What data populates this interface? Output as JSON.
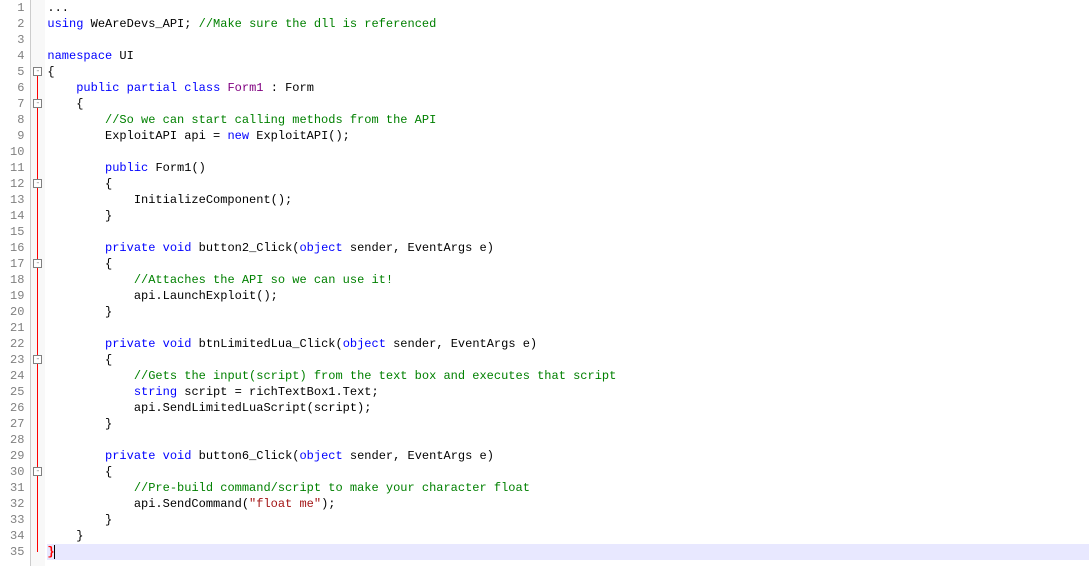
{
  "lines": [
    {
      "n": 1,
      "tokens": [
        {
          "t": "...",
          "c": "ident"
        }
      ]
    },
    {
      "n": 2,
      "tokens": [
        {
          "t": "using",
          "c": "kw"
        },
        {
          "t": " ",
          "c": ""
        },
        {
          "t": "WeAreDevs_API",
          "c": "ns"
        },
        {
          "t": ";",
          "c": "punct"
        },
        {
          "t": " ",
          "c": ""
        },
        {
          "t": "//Make sure the dll is referenced",
          "c": "comment"
        }
      ]
    },
    {
      "n": 3,
      "tokens": []
    },
    {
      "n": 4,
      "tokens": [
        {
          "t": "namespace",
          "c": "kw"
        },
        {
          "t": " ",
          "c": ""
        },
        {
          "t": "UI",
          "c": "ns"
        }
      ]
    },
    {
      "n": 5,
      "tokens": [
        {
          "t": "{",
          "c": "punct"
        }
      ],
      "fold": true
    },
    {
      "n": 6,
      "tokens": [
        {
          "t": "    ",
          "c": ""
        },
        {
          "t": "public",
          "c": "kw"
        },
        {
          "t": " ",
          "c": ""
        },
        {
          "t": "partial",
          "c": "kw"
        },
        {
          "t": " ",
          "c": ""
        },
        {
          "t": "class",
          "c": "kw"
        },
        {
          "t": " ",
          "c": ""
        },
        {
          "t": "Form1",
          "c": "purple"
        },
        {
          "t": " : ",
          "c": "punct"
        },
        {
          "t": "Form",
          "c": "cls"
        }
      ]
    },
    {
      "n": 7,
      "tokens": [
        {
          "t": "    {",
          "c": "punct"
        }
      ],
      "fold": true
    },
    {
      "n": 8,
      "tokens": [
        {
          "t": "        ",
          "c": ""
        },
        {
          "t": "//So we can start calling methods from the API",
          "c": "comment"
        }
      ]
    },
    {
      "n": 9,
      "tokens": [
        {
          "t": "        ",
          "c": ""
        },
        {
          "t": "ExploitAPI",
          "c": "cls"
        },
        {
          "t": " api = ",
          "c": "ident"
        },
        {
          "t": "new",
          "c": "kw"
        },
        {
          "t": " ",
          "c": ""
        },
        {
          "t": "ExploitAPI",
          "c": "cls"
        },
        {
          "t": "();",
          "c": "punct"
        }
      ]
    },
    {
      "n": 10,
      "tokens": []
    },
    {
      "n": 11,
      "tokens": [
        {
          "t": "        ",
          "c": ""
        },
        {
          "t": "public",
          "c": "kw"
        },
        {
          "t": " ",
          "c": ""
        },
        {
          "t": "Form1",
          "c": "cls"
        },
        {
          "t": "()",
          "c": "punct"
        }
      ]
    },
    {
      "n": 12,
      "tokens": [
        {
          "t": "        {",
          "c": "punct"
        }
      ],
      "fold": true
    },
    {
      "n": 13,
      "tokens": [
        {
          "t": "            InitializeComponent();",
          "c": "ident"
        }
      ]
    },
    {
      "n": 14,
      "tokens": [
        {
          "t": "        }",
          "c": "punct"
        }
      ]
    },
    {
      "n": 15,
      "tokens": []
    },
    {
      "n": 16,
      "tokens": [
        {
          "t": "        ",
          "c": ""
        },
        {
          "t": "private",
          "c": "kw"
        },
        {
          "t": " ",
          "c": ""
        },
        {
          "t": "void",
          "c": "kw"
        },
        {
          "t": " ",
          "c": ""
        },
        {
          "t": "button2_Click",
          "c": "method"
        },
        {
          "t": "(",
          "c": "punct"
        },
        {
          "t": "object",
          "c": "kw"
        },
        {
          "t": " sender, ",
          "c": "ident"
        },
        {
          "t": "EventArgs",
          "c": "cls"
        },
        {
          "t": " e)",
          "c": "ident"
        }
      ]
    },
    {
      "n": 17,
      "tokens": [
        {
          "t": "        {",
          "c": "punct"
        }
      ],
      "fold": true
    },
    {
      "n": 18,
      "tokens": [
        {
          "t": "            ",
          "c": ""
        },
        {
          "t": "//Attaches the API so we can use it!",
          "c": "comment"
        }
      ]
    },
    {
      "n": 19,
      "tokens": [
        {
          "t": "            api.LaunchExploit();",
          "c": "ident"
        }
      ]
    },
    {
      "n": 20,
      "tokens": [
        {
          "t": "        }",
          "c": "punct"
        }
      ]
    },
    {
      "n": 21,
      "tokens": []
    },
    {
      "n": 22,
      "tokens": [
        {
          "t": "        ",
          "c": ""
        },
        {
          "t": "private",
          "c": "kw"
        },
        {
          "t": " ",
          "c": ""
        },
        {
          "t": "void",
          "c": "kw"
        },
        {
          "t": " ",
          "c": ""
        },
        {
          "t": "btnLimitedLua_Click",
          "c": "method"
        },
        {
          "t": "(",
          "c": "punct"
        },
        {
          "t": "object",
          "c": "kw"
        },
        {
          "t": " sender, ",
          "c": "ident"
        },
        {
          "t": "EventArgs",
          "c": "cls"
        },
        {
          "t": " e)",
          "c": "ident"
        }
      ]
    },
    {
      "n": 23,
      "tokens": [
        {
          "t": "        {",
          "c": "punct"
        }
      ],
      "fold": true
    },
    {
      "n": 24,
      "tokens": [
        {
          "t": "            ",
          "c": ""
        },
        {
          "t": "//Gets the input(script) from the text box and executes that script",
          "c": "comment"
        }
      ]
    },
    {
      "n": 25,
      "tokens": [
        {
          "t": "            ",
          "c": ""
        },
        {
          "t": "string",
          "c": "kw"
        },
        {
          "t": " script = richTextBox1.Text;",
          "c": "ident"
        }
      ]
    },
    {
      "n": 26,
      "tokens": [
        {
          "t": "            api.SendLimitedLuaScript(script);",
          "c": "ident"
        }
      ]
    },
    {
      "n": 27,
      "tokens": [
        {
          "t": "        }",
          "c": "punct"
        }
      ]
    },
    {
      "n": 28,
      "tokens": []
    },
    {
      "n": 29,
      "tokens": [
        {
          "t": "        ",
          "c": ""
        },
        {
          "t": "private",
          "c": "kw"
        },
        {
          "t": " ",
          "c": ""
        },
        {
          "t": "void",
          "c": "kw"
        },
        {
          "t": " ",
          "c": ""
        },
        {
          "t": "button6_Click",
          "c": "method"
        },
        {
          "t": "(",
          "c": "punct"
        },
        {
          "t": "object",
          "c": "kw"
        },
        {
          "t": " sender, ",
          "c": "ident"
        },
        {
          "t": "EventArgs",
          "c": "cls"
        },
        {
          "t": " e)",
          "c": "ident"
        }
      ]
    },
    {
      "n": 30,
      "tokens": [
        {
          "t": "        {",
          "c": "punct"
        }
      ],
      "fold": true
    },
    {
      "n": 31,
      "tokens": [
        {
          "t": "            ",
          "c": ""
        },
        {
          "t": "//Pre-build command/script to make your character float",
          "c": "comment"
        }
      ]
    },
    {
      "n": 32,
      "tokens": [
        {
          "t": "            api.SendCommand(",
          "c": "ident"
        },
        {
          "t": "\"float me\"",
          "c": "str"
        },
        {
          "t": ");",
          "c": "punct"
        }
      ]
    },
    {
      "n": 33,
      "tokens": [
        {
          "t": "        }",
          "c": "punct"
        }
      ]
    },
    {
      "n": 34,
      "tokens": [
        {
          "t": "    }",
          "c": "punct"
        }
      ]
    },
    {
      "n": 35,
      "tokens": [
        {
          "t": "}",
          "c": "red-brace"
        }
      ],
      "highlight": true,
      "cursor": true
    }
  ],
  "foldBoxes": [
    5,
    7,
    12,
    17,
    23,
    30
  ],
  "foldLineStart": 5,
  "foldLineEnd": 35
}
